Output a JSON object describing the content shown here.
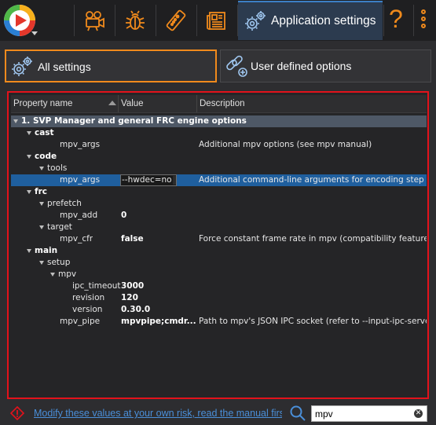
{
  "toolbar": {
    "app_logo": "svp-logo-icon",
    "buttons": [
      {
        "icon": "video-camera-icon"
      },
      {
        "icon": "bug-icon"
      },
      {
        "icon": "remote-control-icon"
      },
      {
        "icon": "newspaper-icon"
      }
    ],
    "active_tab_label": "Application settings",
    "active_tab_icon": "gears-icon",
    "help_label": "?",
    "accent_color": "#f08a1c"
  },
  "mode_tabs": [
    {
      "label": "All settings",
      "icon": "gears-icon",
      "selected": true
    },
    {
      "label": "User defined options",
      "icon": "link-add-icon",
      "selected": false
    }
  ],
  "grid": {
    "columns": [
      "Property name",
      "Value",
      "Description"
    ],
    "rows": [
      {
        "kind": "root",
        "name": "1. SVP Manager and general FRC engine options",
        "value": "",
        "desc": ""
      },
      {
        "kind": "group",
        "name": "cast",
        "value": "",
        "desc": ""
      },
      {
        "kind": "item",
        "name": "mpv_args",
        "value": "",
        "desc": "Additional mpv options (see mpv manual)"
      },
      {
        "kind": "group",
        "name": "code",
        "value": "",
        "desc": ""
      },
      {
        "kind": "subgroup",
        "name": "tools",
        "value": "",
        "desc": ""
      },
      {
        "kind": "selected",
        "name": "mpv_args",
        "value": "--hwdec=no",
        "desc": "Additional command-line arguments for encoding step (via..."
      },
      {
        "kind": "group",
        "name": "frc",
        "value": "",
        "desc": ""
      },
      {
        "kind": "subgroup",
        "name": "prefetch",
        "value": "",
        "desc": ""
      },
      {
        "kind": "item",
        "name": "mpv_add",
        "value": "0",
        "desc": ""
      },
      {
        "kind": "subgroup",
        "name": "target",
        "value": "",
        "desc": ""
      },
      {
        "kind": "item",
        "name": "mpv_cfr",
        "value": "false",
        "desc": "Force constant frame rate in mpv (compatibility feature)"
      },
      {
        "kind": "group",
        "name": "main",
        "value": "",
        "desc": ""
      },
      {
        "kind": "subgroup",
        "name": "setup",
        "value": "",
        "desc": ""
      },
      {
        "kind": "subsubgroup",
        "name": "mpv",
        "value": "",
        "desc": ""
      },
      {
        "kind": "deep",
        "name": "ipc_timeout",
        "value": "3000",
        "desc": ""
      },
      {
        "kind": "deep",
        "name": "revision",
        "value": "120",
        "desc": ""
      },
      {
        "kind": "deep",
        "name": "version",
        "value": "0.30.0",
        "desc": ""
      },
      {
        "kind": "item",
        "name": "mpv_pipe",
        "value": "mpvpipe;cmdr...",
        "desc": "Path to mpv's JSON IPC socket (refer to --input-ipc-serve..."
      }
    ]
  },
  "footer": {
    "warning_link": "Modify these values at your own risk, read the manual first",
    "search_value": "mpv",
    "warning_color": "#e2121b"
  }
}
